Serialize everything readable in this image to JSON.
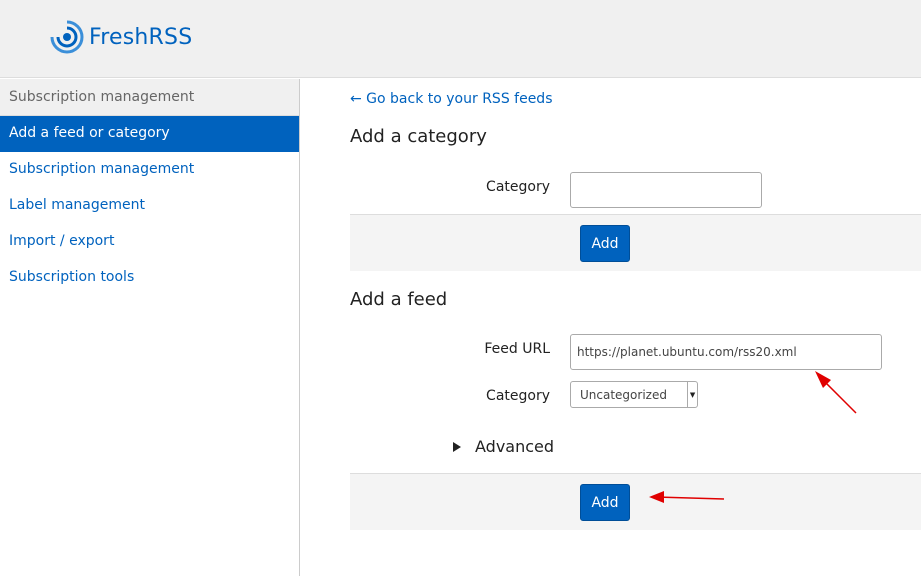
{
  "header": {
    "app_name": "FreshRSS"
  },
  "sidebar": {
    "title": "Subscription management",
    "items": [
      {
        "label": "Add a feed or category",
        "active": true
      },
      {
        "label": "Subscription management",
        "active": false
      },
      {
        "label": "Label management",
        "active": false
      },
      {
        "label": "Import / export",
        "active": false
      },
      {
        "label": "Subscription tools",
        "active": false
      }
    ]
  },
  "main": {
    "back_link": "← Go back to your RSS feeds",
    "add_category": {
      "title": "Add a category",
      "category_label": "Category",
      "category_value": "",
      "add_label": "Add"
    },
    "add_feed": {
      "title": "Add a feed",
      "feed_url_label": "Feed URL",
      "feed_url_value": "https://planet.ubuntu.com/rss20.xml",
      "category_label": "Category",
      "category_selected": "Uncategorized",
      "advanced_label": "Advanced",
      "add_label": "Add"
    }
  },
  "colors": {
    "accent": "#0062be",
    "annotation": "#e00000"
  }
}
